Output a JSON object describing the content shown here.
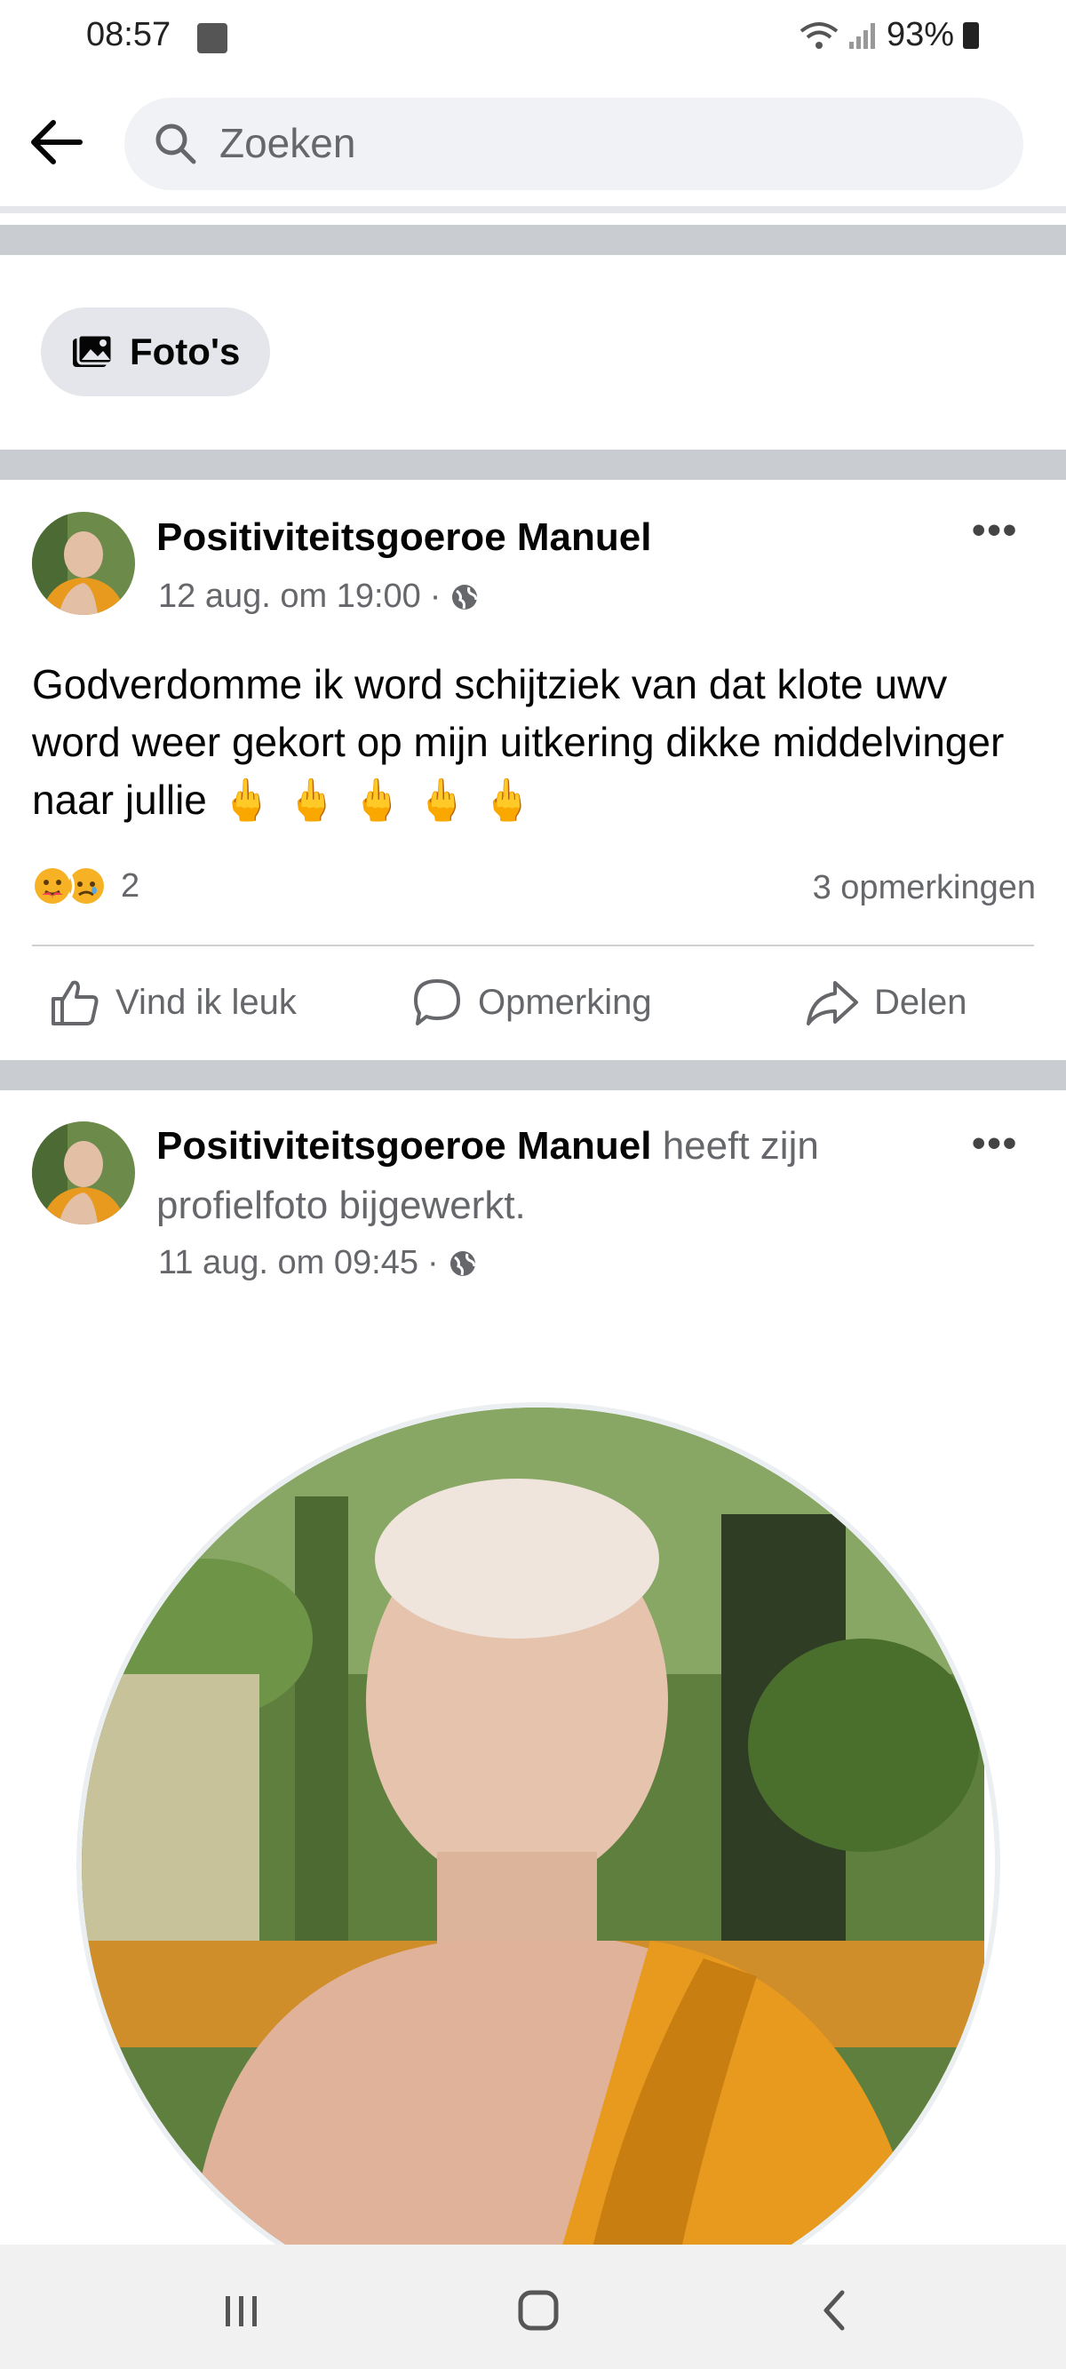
{
  "status_bar": {
    "time": "08:57",
    "battery": "93%"
  },
  "search": {
    "placeholder": "Zoeken"
  },
  "photos_chip": {
    "label": "Foto's"
  },
  "post1": {
    "author": "Positiviteitsgoeroe Manuel",
    "timestamp": "12 aug. om 19:00",
    "separator": "·",
    "text": "Godverdomme ik word schijtziek van  dat klote uwv word weer gekort op mijn uitkering dikke middelvinger naar jullie",
    "emojis": [
      "🖕",
      "🖕",
      "🖕",
      "🖕",
      "🖕"
    ],
    "reaction_count": "2",
    "comments": "3 opmerkingen",
    "actions": {
      "like": "Vind ik leuk",
      "comment": "Opmerking",
      "share": "Delen"
    }
  },
  "post2": {
    "author": "Positiviteitsgoeroe Manuel",
    "verb_line1": "heeft zijn",
    "verb_line2": "profielfoto bijgewerkt.",
    "timestamp": "11 aug. om 09:45",
    "separator": "·"
  },
  "colors": {
    "background": "#ffffff",
    "divider": "#c9ccd1",
    "search_bg": "#f0f2f5",
    "secondary_text": "#65676b",
    "robe": "#e89a1e"
  },
  "icons": [
    "back-arrow-icon",
    "search-icon",
    "photos-icon",
    "more-icon",
    "globe-icon",
    "like-icon",
    "comment-icon",
    "share-icon",
    "recents-icon",
    "home-icon",
    "back-icon"
  ]
}
